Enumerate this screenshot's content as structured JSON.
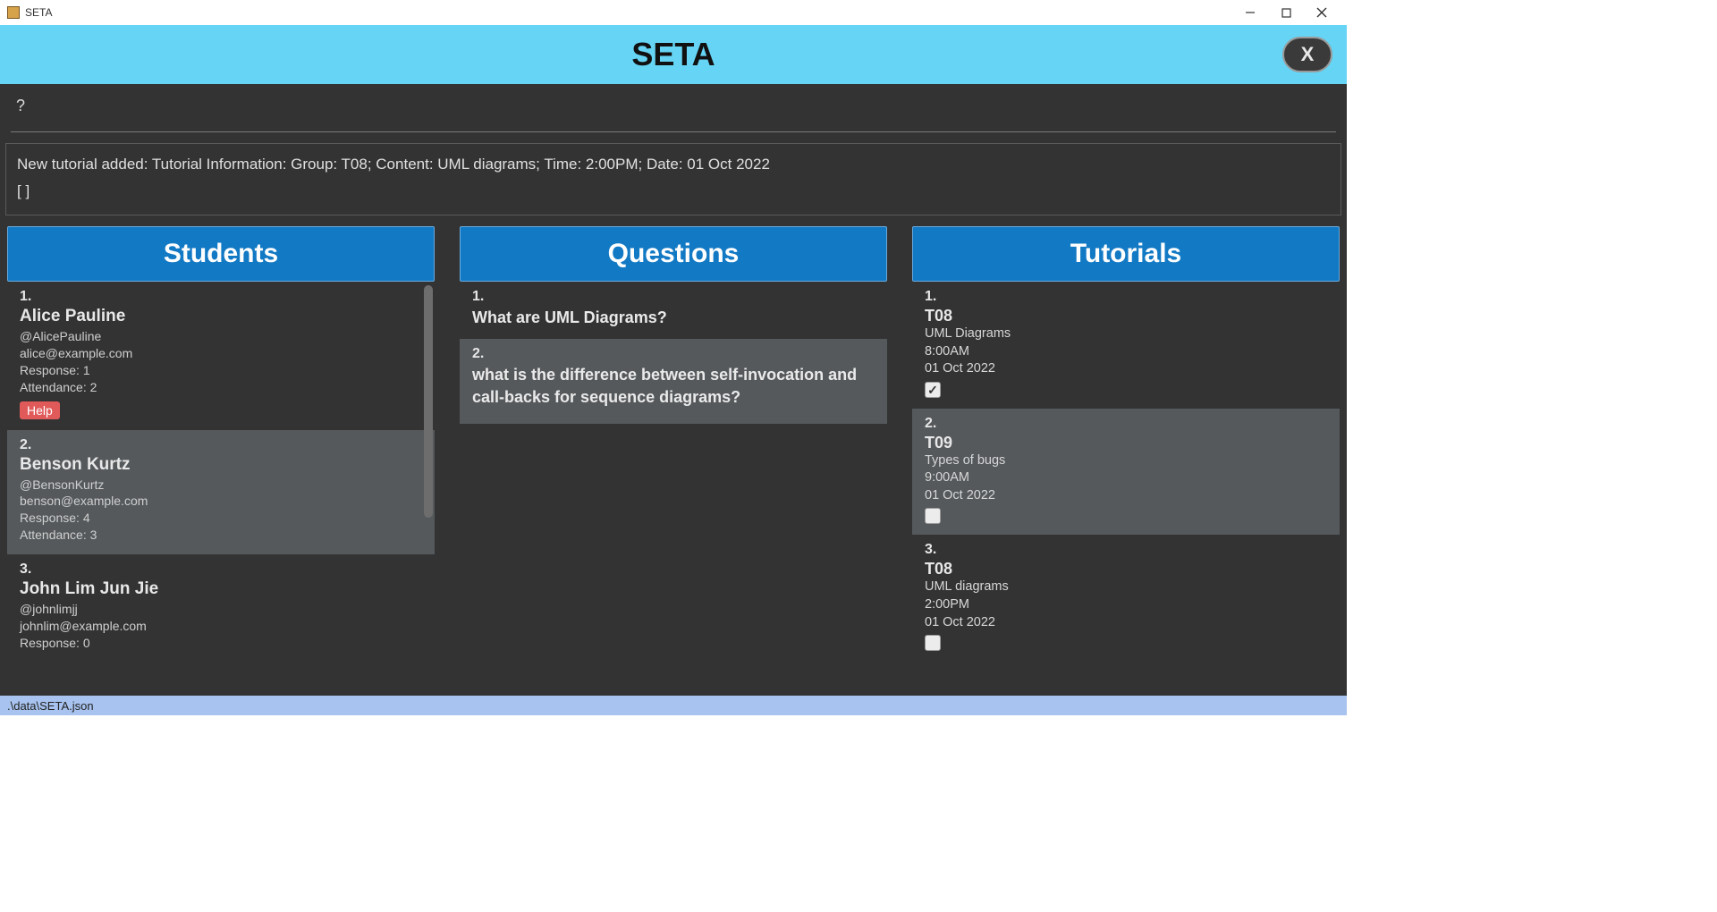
{
  "titlebar": {
    "app_name": "SETA"
  },
  "banner": {
    "title": "SETA",
    "close_label": "X"
  },
  "prompt": {
    "char": "?"
  },
  "status": {
    "line1": "New tutorial added: Tutorial Information: Group: T08; Content: UML diagrams; Time: 2:00PM; Date: 01 Oct 2022",
    "line2": "[ ]"
  },
  "columns": {
    "students": {
      "header": "Students",
      "items": [
        {
          "idx": "1.",
          "name": "Alice Pauline",
          "handle": "@AlicePauline",
          "email": "alice@example.com",
          "response": "Response: 1",
          "attendance": "Attendance: 2",
          "help": "Help",
          "shade": "dark"
        },
        {
          "idx": "2.",
          "name": "Benson Kurtz",
          "handle": "@BensonKurtz",
          "email": "benson@example.com",
          "response": "Response: 4",
          "attendance": "Attendance: 3",
          "shade": "light"
        },
        {
          "idx": "3.",
          "name": "John Lim Jun Jie",
          "handle": "@johnlimjj",
          "email": "johnlim@example.com",
          "response": "Response: 0",
          "shade": "dark"
        }
      ]
    },
    "questions": {
      "header": "Questions",
      "items": [
        {
          "idx": "1.",
          "text": "What are UML Diagrams?",
          "shade": "dark"
        },
        {
          "idx": "2.",
          "text": "what is the difference between self-invocation and call-backs for sequence diagrams?",
          "shade": "light"
        }
      ]
    },
    "tutorials": {
      "header": "Tutorials",
      "items": [
        {
          "idx": "1.",
          "group": "T08",
          "content": "UML Diagrams",
          "time": "8:00AM",
          "date": "01 Oct 2022",
          "checked": true,
          "shade": "dark"
        },
        {
          "idx": "2.",
          "group": "T09",
          "content": "Types of bugs",
          "time": "9:00AM",
          "date": "01 Oct 2022",
          "checked": false,
          "shade": "light"
        },
        {
          "idx": "3.",
          "group": "T08",
          "content": "UML diagrams",
          "time": "2:00PM",
          "date": "01 Oct 2022",
          "checked": false,
          "shade": "dark"
        }
      ]
    }
  },
  "statusbar": {
    "path": ".\\data\\SETA.json"
  }
}
